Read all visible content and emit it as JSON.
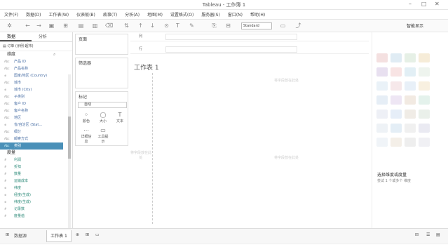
{
  "window": {
    "title": "Tableau - 工作簿 1"
  },
  "menu": [
    "文件(F)",
    "数据(D)",
    "工作表(W)",
    "仪表板(B)",
    "故事(T)",
    "分析(A)",
    "地图(M)",
    "设置格式(O)",
    "服务器(S)",
    "窗口(N)",
    "帮助(H)"
  ],
  "toolbar": {
    "fit": "Standard",
    "show_me": "智能显示"
  },
  "data_pane": {
    "tabs": [
      "数据",
      "分析"
    ],
    "datasource": "订单 (示例-超市)",
    "dimensions_header": "维度",
    "dimensions": [
      {
        "type": "Abc",
        "name": "产品 ID"
      },
      {
        "type": "Abc",
        "name": "产品名称"
      },
      {
        "type": "⊕",
        "name": "国家/地区 (Country)"
      },
      {
        "type": "Abc",
        "name": "城市"
      },
      {
        "type": "⊕",
        "name": "城市 (City)"
      },
      {
        "type": "Abc",
        "name": "子类别"
      },
      {
        "type": "Abc",
        "name": "客户 ID"
      },
      {
        "type": "Abc",
        "name": "客户名称"
      },
      {
        "type": "Abc",
        "name": "地区"
      },
      {
        "type": "⊕",
        "name": "省/自治区 (Stat..."
      },
      {
        "type": "Abc",
        "name": "细分"
      },
      {
        "type": "Abc",
        "name": "邮寄方式"
      },
      {
        "type": "Abc",
        "name": "类别"
      }
    ],
    "measures_header": "度量",
    "measures": [
      {
        "type": "#",
        "name": "利润"
      },
      {
        "type": "#",
        "name": "折扣"
      },
      {
        "type": "#",
        "name": "数量"
      },
      {
        "type": "#",
        "name": "运输成本"
      },
      {
        "type": "⊕",
        "name": "纬度"
      },
      {
        "type": "⊕",
        "name": "经度(生成)"
      },
      {
        "type": "⊕",
        "name": "纬度(生成)"
      },
      {
        "type": "#",
        "name": "记录数"
      },
      {
        "type": "#",
        "name": "度量值"
      }
    ]
  },
  "shelves": {
    "pages": "页面",
    "filters": "筛选器",
    "marks": "标记",
    "mark_type": "自动",
    "mark_buttons": [
      {
        "glyph": "⁘",
        "label": "颜色"
      },
      {
        "glyph": "◯",
        "label": "大小"
      },
      {
        "glyph": "T",
        "label": "文本"
      },
      {
        "glyph": "⋯",
        "label": "详细信息"
      },
      {
        "glyph": "▭",
        "label": "工具提示"
      }
    ],
    "columns_label": "列",
    "rows_label": "行"
  },
  "canvas": {
    "sheet_title": "工作表 1",
    "hint_top": "将字段放在此处",
    "hint_left": "将字段放在此处",
    "hint_center": "将字段放在此处"
  },
  "show_me": {
    "title": "选择维度或度量",
    "subtitle": "尝试 1 个或多个 维度"
  },
  "bottom": {
    "source_tab": "数据源",
    "sheet_tab": "工作表 1"
  },
  "thumb_colors": [
    "#e8a0a0",
    "#9ac0d8",
    "#a0c8a0",
    "#e0c080",
    "#c8a8d8",
    "#f0b0b0",
    "#a8d0e0"
  ]
}
